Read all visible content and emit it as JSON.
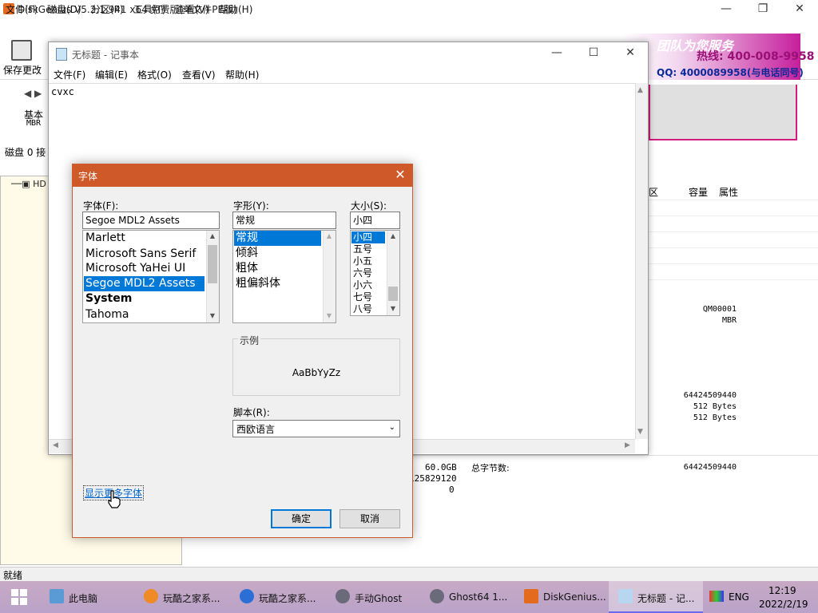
{
  "diskgenius": {
    "title": "DiskGenius V5.2.1.941 x64 免费版(单文件PE版)",
    "menu": [
      "文件(F)",
      "磁盘(D)",
      "分区(P)",
      "工具(T)",
      "查看(V)",
      "帮助(H)"
    ],
    "save_label": "保存更改",
    "banner_team": "团队为您服务",
    "banner_tel": "热线: 400-008-9958",
    "banner_qq": "QQ: 4000089958(与电话同号)",
    "disk_type": "基本",
    "disk_style": "MBR",
    "disk_line": "磁盘 0 接",
    "tree_item": "HD",
    "columns": [
      "区",
      "容量",
      "属性"
    ],
    "right_values": {
      "serial": "QM00001",
      "partition_style": "MBR",
      "total_bytes_1": "64424509440",
      "sector_size": "512 Bytes",
      "physical_sector": "512 Bytes",
      "total_bytes_2": "64424509440"
    },
    "lower": {
      "capacity": "60.0GB",
      "sectors": "125829120",
      "zero": "0",
      "total_bytes_label": "总字节数:"
    },
    "status": "就绪"
  },
  "notepad": {
    "title": "无标题 - 记事本",
    "menu": [
      "文件(F)",
      "编辑(E)",
      "格式(O)",
      "查看(V)",
      "帮助(H)"
    ],
    "content": "cvxc"
  },
  "font_dialog": {
    "title": "字体",
    "font_label": "字体(F):",
    "font_value": "Segoe MDL2 Assets",
    "fonts": [
      "Marlett",
      "Microsoft Sans Serif",
      "Microsoft YaHei UI",
      "Segoe MDL2 Assets",
      "System",
      "Tahoma"
    ],
    "selected_font": "Segoe MDL2 Assets",
    "style_label": "字形(Y):",
    "style_value": "常规",
    "styles": [
      "常规",
      "倾斜",
      "粗体",
      "粗偏斜体"
    ],
    "selected_style": "常规",
    "size_label": "大小(S):",
    "size_value": "小四",
    "sizes": [
      "小四",
      "五号",
      "小五",
      "六号",
      "小六",
      "七号",
      "八号"
    ],
    "selected_size": "小四",
    "sample_title": "示例",
    "sample_text": "AaBbYyZz",
    "script_label": "脚本(R):",
    "script_value": "西欧语言",
    "more_fonts": "显示更多字体",
    "ok": "确定",
    "cancel": "取消"
  },
  "taskbar": {
    "items": [
      "此电脑",
      "玩酷之家系...",
      "玩酷之家系...",
      "手动Ghost",
      "Ghost64 1...",
      "DiskGenius...",
      "无标题 - 记..."
    ],
    "lang": "ENG",
    "time": "12:19",
    "date": "2022/2/19"
  },
  "colors": {
    "dialog_accent": "#d0592a",
    "selection": "#0078d7",
    "banner": "#c61f9c"
  }
}
